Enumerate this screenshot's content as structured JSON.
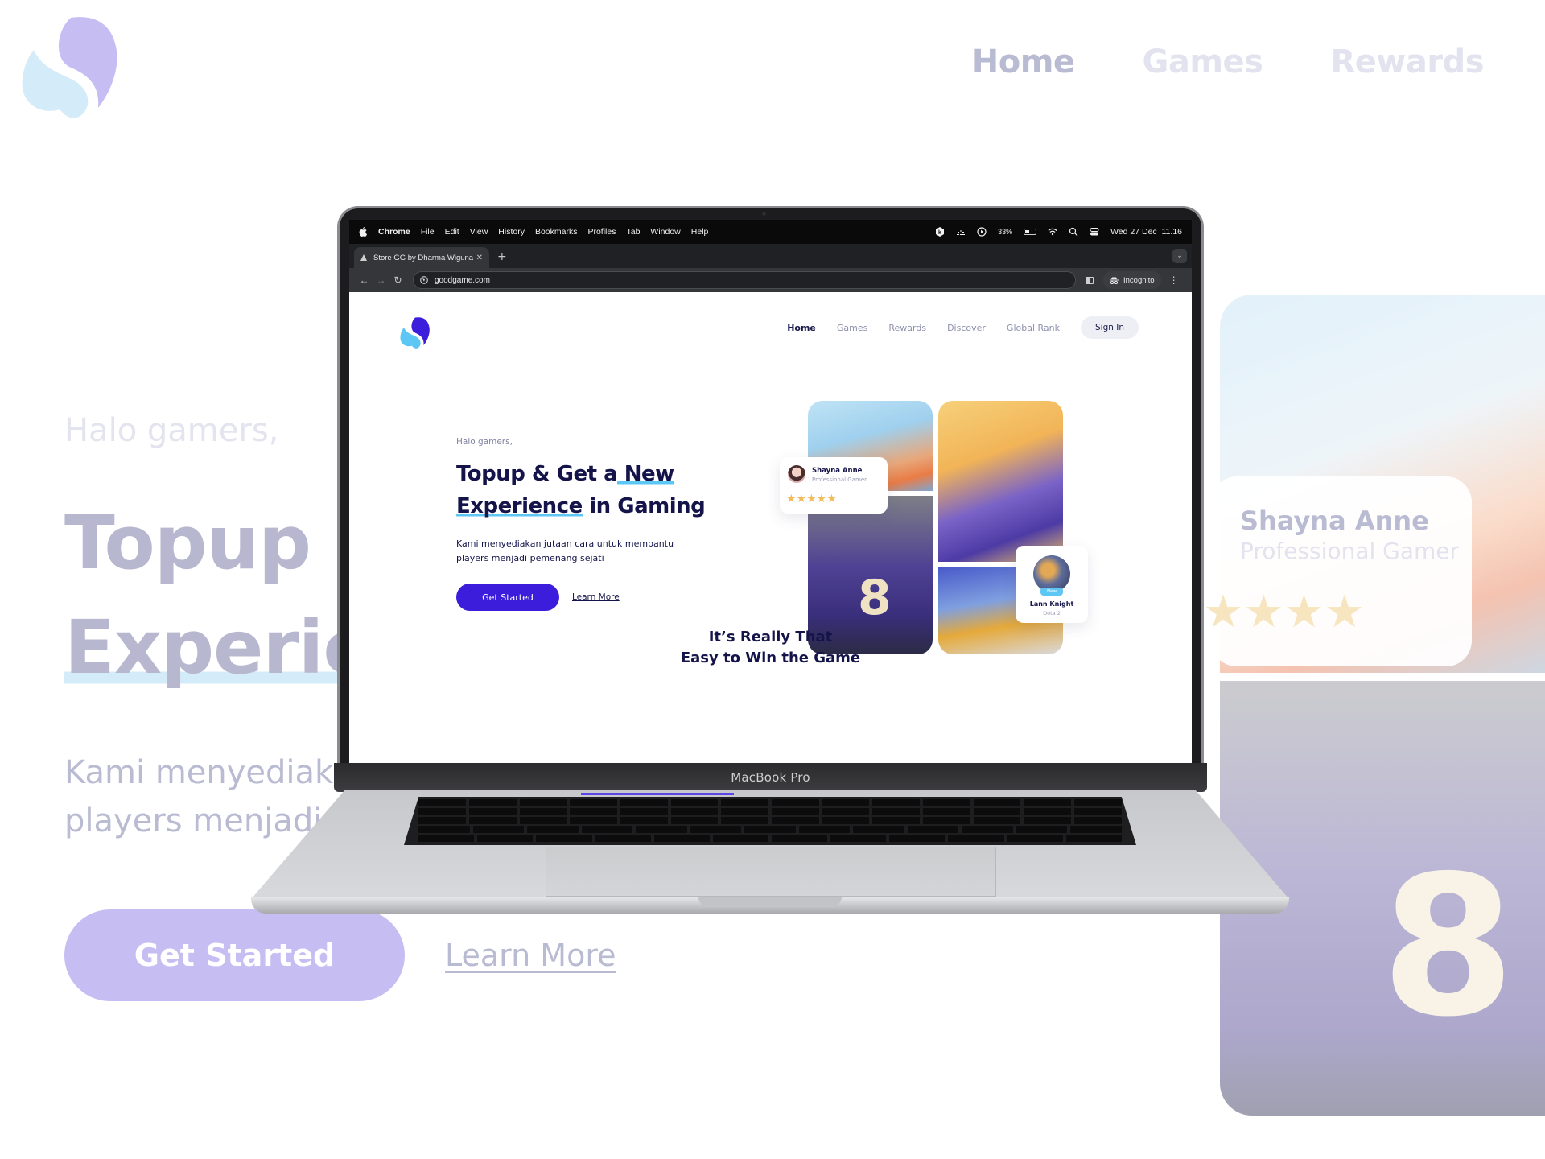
{
  "background_page": {
    "nav": {
      "items": [
        {
          "label": "Home",
          "active": true
        },
        {
          "label": "Games",
          "active": false
        },
        {
          "label": "Rewards",
          "active": false
        }
      ]
    },
    "hero": {
      "greeting": "Halo gamers,",
      "headline_line1": "Topup &",
      "headline_line2": "Experie",
      "subtitle_line1": "Kami menyediak",
      "subtitle_line2": "players menjadi",
      "primary_cta": "Get Started",
      "secondary_cta": "Learn More"
    },
    "review_card": {
      "name": "Shayna Anne",
      "role": "Professional Gamer",
      "stars": "★★★★"
    },
    "photo_number": "8"
  },
  "laptop": {
    "model_label": "MacBook Pro",
    "menubar": {
      "app": "Chrome",
      "menus": [
        "File",
        "Edit",
        "View",
        "History",
        "Bookmarks",
        "Profiles",
        "Tab",
        "Window",
        "Help"
      ],
      "battery_percent": "33%",
      "battery_level": 0.33,
      "datetime": "Wed 27 Dec  11.16"
    },
    "browser": {
      "tab_title": "Store GG by Dharma Wiguna",
      "tab_close": "✕",
      "new_tab": "+",
      "tab_menu": "⌄",
      "url": "goodgame.com",
      "incognito_label": "Incognito",
      "back": "←",
      "forward": "→",
      "reload": "↻",
      "menu": "⋮"
    },
    "website": {
      "nav": {
        "items": [
          {
            "label": "Home",
            "active": true
          },
          {
            "label": "Games",
            "active": false
          },
          {
            "label": "Rewards",
            "active": false
          },
          {
            "label": "Discover",
            "active": false
          },
          {
            "label": "Global Rank",
            "active": false
          }
        ],
        "sign_in": "Sign In"
      },
      "hero": {
        "greeting": "Halo gamers,",
        "headline_part1": "Topup & Get a",
        "headline_highlight1": " New",
        "headline_highlight2": "Experience",
        "headline_part2": " in Gaming",
        "description_line1": "Kami menyediakan jutaan cara untuk membantu",
        "description_line2": "players menjadi pemenang sejati",
        "primary_cta": "Get Started",
        "secondary_cta": "Learn More"
      },
      "review_card": {
        "name": "Shayna Anne",
        "role": "Professional Gamer",
        "rating": 5,
        "stars": "★★★★★"
      },
      "player_card": {
        "badge": "New",
        "name": "Lann Knight",
        "game": "Dota 2"
      },
      "photo_number": "8",
      "section_title_line1": "It’s Really That",
      "section_title_line2": "Easy to Win the Game"
    }
  },
  "colors": {
    "brand_primary": "#3b1ddb",
    "brand_dark": "#14144a",
    "highlight": "#5cc6f5",
    "star": "#f2bc5c",
    "logo_purple": "#c6bdf3",
    "logo_blue": "#d4ecf9"
  }
}
